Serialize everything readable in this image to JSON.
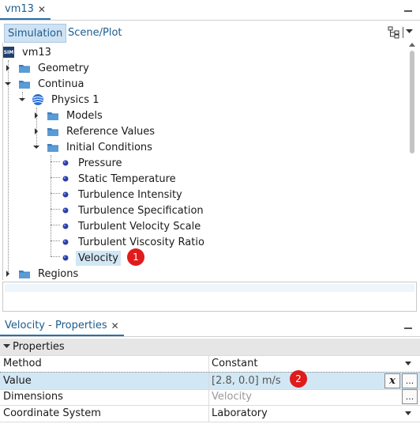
{
  "window": {
    "tab_title": "vm13",
    "tab_close": "✕"
  },
  "toolbar": {
    "tabs": [
      {
        "label": "Simulation"
      },
      {
        "label": "Scene/Plot"
      }
    ]
  },
  "tree": {
    "root": {
      "label": "vm13",
      "icon_text": "SIM"
    },
    "items": {
      "geometry": "Geometry",
      "continua": "Continua",
      "physics1": "Physics 1",
      "models": "Models",
      "reference_values": "Reference Values",
      "initial_conditions": "Initial Conditions",
      "pressure": "Pressure",
      "static_temperature": "Static Temperature",
      "turbulence_intensity": "Turbulence Intensity",
      "turbulence_specification": "Turbulence Specification",
      "turbulent_velocity_scale": "Turbulent Velocity Scale",
      "turbulent_viscosity_ratio": "Turbulent Viscosity Ratio",
      "velocity": "Velocity",
      "regions": "Regions"
    }
  },
  "annotations": {
    "badge1": "1",
    "badge2": "2"
  },
  "properties_panel": {
    "tab_title": "Velocity - Properties",
    "tab_close": "✕",
    "group": "Properties",
    "rows": [
      {
        "name": "Method",
        "value": "Constant"
      },
      {
        "name": "Value",
        "value": "[2.8, 0.0] m/s"
      },
      {
        "name": "Dimensions",
        "value": "Velocity"
      },
      {
        "name": "Coordinate System",
        "value": "Laboratory"
      }
    ],
    "buttons": {
      "expression": "x",
      "more": "..."
    }
  },
  "colors": {
    "accent": "#1c5c8e",
    "selection": "#d2e7f4",
    "badge": "#e01b1b",
    "folder": "#3d7fc1",
    "bullet": "#2b3fa8"
  }
}
